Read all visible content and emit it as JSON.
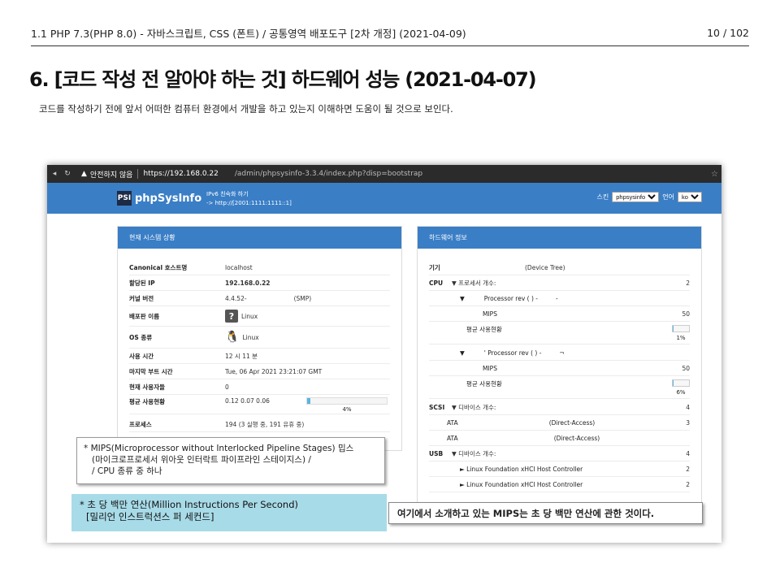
{
  "doc": {
    "header_left": "1.1 PHP 7.3(PHP 8.0) - 자바스크립트, CSS (폰트) / 공통영역 배포도구 [2차 개정] (2021-04-09)",
    "header_right": "10 / 102",
    "title": "6. [코드 작성 전 알아야 하는 것] 하드웨어 성능 (2021-04-07)",
    "desc": "코드를 작성하기 전에 앞서 어떠한 컴퓨터 환경에서 개발을 하고 있는지 이해하면 도움이 될 것으로 보인다."
  },
  "browser": {
    "security": "안전하지 않음",
    "https": "https://",
    "host": "192.168.0.22",
    "path": "/admin/phpsysinfo-3.3.4/index.php?disp=bootstrap"
  },
  "app": {
    "logo_mark": "PSI",
    "logo_text": "phpSysInfo",
    "ipv6_line1": "IPv6 친숙화 하기",
    "ipv6_line2": "-> http://[2001:1111:1111::1]",
    "theme_label": "스킨",
    "theme_value": "phpsysinfo",
    "lang_label": "언어",
    "lang_value": "ko"
  },
  "left_panel": {
    "title": "현재 시스템 상황",
    "rows": {
      "hostname": {
        "k": "Canonical 호스트명",
        "v": "localhost"
      },
      "ip": {
        "k": "할당된 IP",
        "v": "192.168.0.22"
      },
      "kernel": {
        "k": "커널 버전",
        "v": "4.4.52-",
        "v2": "(SMP)"
      },
      "distro": {
        "k": "배포판 이름",
        "v": "Linux"
      },
      "os": {
        "k": "OS 종류",
        "v": "Linux"
      },
      "uptime": {
        "k": "사용 시간",
        "v": "12 시 11 분"
      },
      "lastboot": {
        "k": "마지막 부트 시간",
        "v": "Tue, 06 Apr 2021 23:21:07 GMT"
      },
      "users": {
        "k": "현재 사용자들",
        "v": "0"
      },
      "load": {
        "k": "평균 사용현황",
        "v": "0.12 0.07 0.06",
        "pct": "4%",
        "fraction": 0.04
      },
      "procs": {
        "k": "프로세스",
        "v": "194 (3 실행 중, 191 유휴 중)"
      }
    }
  },
  "right_panel": {
    "title": "하드웨어 정보",
    "machine": {
      "k": "기기",
      "v": "(Device Tree)"
    },
    "cpu": {
      "k": "CPU",
      "v": "▼ 프로세서 개수:",
      "n": "2"
    },
    "cpu1": {
      "label": "▼",
      "name": "Processor rev   (    ) -",
      "tail": "-"
    },
    "mips1": {
      "k": "MIPS",
      "n": "50"
    },
    "load1": {
      "k": "평균 사용현황",
      "pct": "1%",
      "fraction": 0.01
    },
    "cpu2": {
      "label": "▼",
      "name": "' Processor rev   (    ) -",
      "tail": "¬"
    },
    "mips2": {
      "k": "MIPS",
      "n": "50"
    },
    "load2": {
      "k": "평균 사용현황",
      "pct": "6%",
      "fraction": 0.06
    },
    "scsi": {
      "k": "SCSI",
      "v": "▼ 디바이스 개수:",
      "n": "4"
    },
    "ata1": {
      "k": "ATA",
      "v": "(Direct-Access)",
      "n": "3"
    },
    "ata2": {
      "k": "ATA",
      "v": "(Direct-Access)"
    },
    "usb": {
      "k": "USB",
      "v": "▼ 디바이스 개수:",
      "n": "4"
    },
    "usb1": {
      "v": "► Linux Foundation xHCI Host Controller",
      "n": "2"
    },
    "usb2": {
      "v": "► Linux Foundation xHCI Host Controller",
      "n": "2"
    }
  },
  "callouts": {
    "mips_line1": "* MIPS(Microprocessor without Interlocked Pipeline Stages) 밉스",
    "mips_line2": "(마이크로프로세서 위아웃 인터락트 파이프라인 스테이지스) /",
    "mips_line3": "/ CPU 종류 중 하나",
    "mips2_line1": "* 초 당 백만 연산(Million Instructions Per Second)",
    "mips2_line2": "[밀리언 인스트럭션스 퍼 세컨드]",
    "note": "여기에서 소개하고 있는 MIPS는 초 당 백만 연산에 관한 것이다."
  }
}
